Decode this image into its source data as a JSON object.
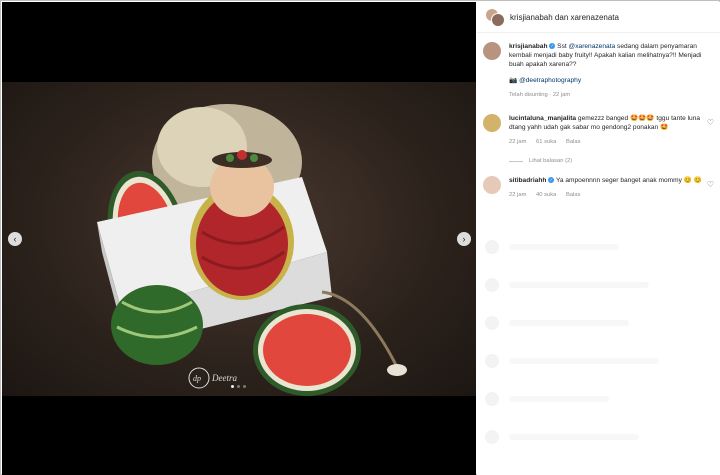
{
  "post": {
    "header_title": "krisjianabah dan xarenazenata",
    "watermark": "Deetra"
  },
  "caption": {
    "username": "krisjianabah",
    "text_before": "Sst ",
    "mention": "@xarenazenata",
    "text_after": " sedang dalam penyamaran kembali menjadi baby fruity!! Apakah kalian melihatnya?!! Menjadi buah apakah xarena??",
    "credit": "@deetraphotography",
    "edited": "Telah disunting · 22 jam"
  },
  "comments": [
    {
      "username": "lucintaluna_manjalita",
      "text": "gemezzz banged 🤩🤩🤩 tggu tante luna dtang yahh udah gak sabar mo gendong2 ponakan 🤩",
      "time": "22 jam",
      "likes": "61 suka",
      "reply": "Balas",
      "view_replies": "Lihat balasan (2)"
    },
    {
      "username": "sitibadriahh",
      "text": "Ya ampoennnn seger banget anak mommy 😊 😊",
      "time": "22 jam",
      "likes": "40 suka",
      "reply": "Balas"
    }
  ],
  "colors": {
    "bg_dark": "#000000",
    "link": "#00376b",
    "verified": "#3897f0",
    "meta_text": "#8e8e8e"
  }
}
